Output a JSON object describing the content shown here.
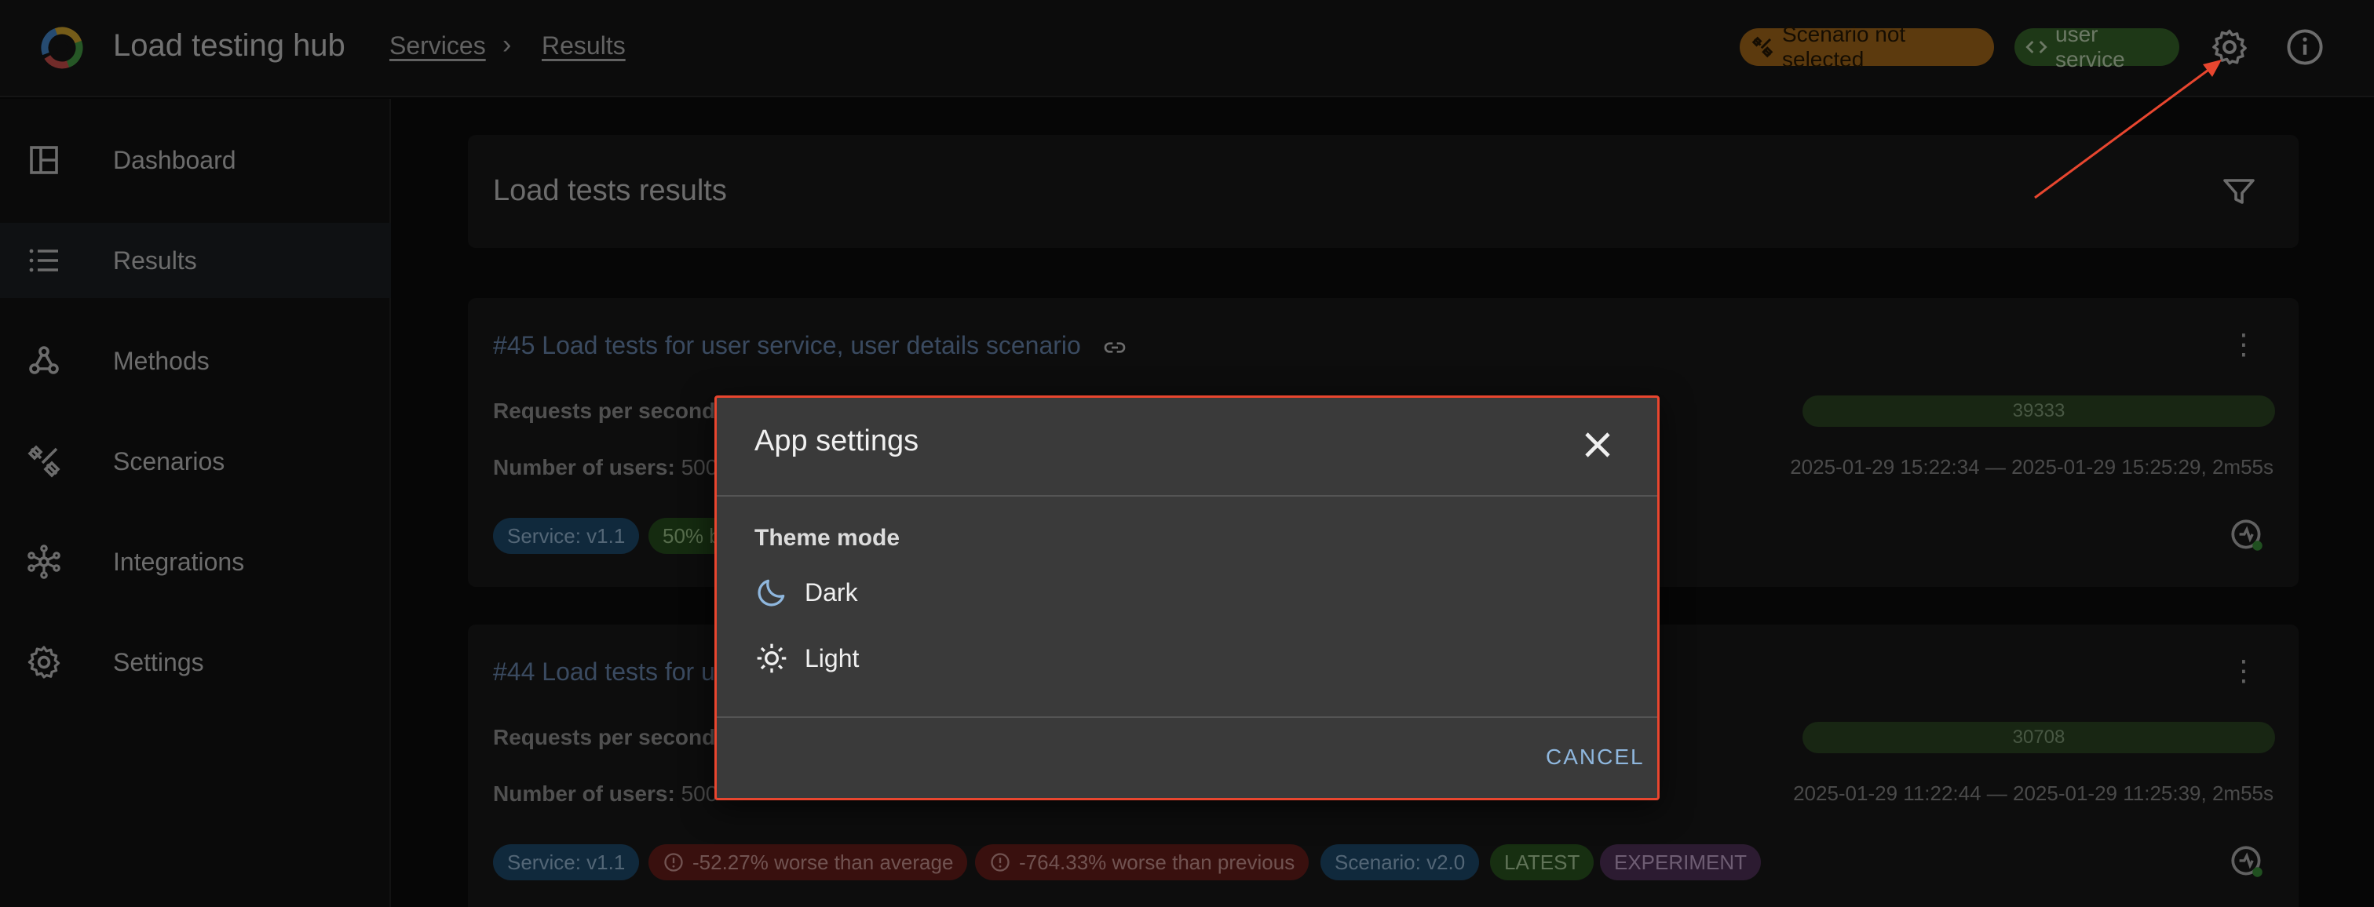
{
  "topbar": {
    "app_title": "Load testing hub",
    "breadcrumb": [
      "Services",
      "Results"
    ],
    "scenario_chip": "Scenario not selected",
    "service_chip": "user service"
  },
  "sidebar": {
    "items": [
      {
        "label": "Dashboard",
        "icon": "dashboard-icon"
      },
      {
        "label": "Results",
        "icon": "list-icon",
        "active": true
      },
      {
        "label": "Methods",
        "icon": "webhook-icon"
      },
      {
        "label": "Scenarios",
        "icon": "tools-icon"
      },
      {
        "label": "Integrations",
        "icon": "hub-icon"
      },
      {
        "label": "Settings",
        "icon": "gear-icon"
      }
    ]
  },
  "results": {
    "header_title": "Load tests results",
    "cards": [
      {
        "title": "#45 Load tests for user service, user details scenario",
        "rps_label": "Requests per second:",
        "users_label": "Number of users:",
        "users_value": "500",
        "rps_bar": "39333",
        "date_range": "2025-01-29 15:22:34 — 2025-01-29 15:25:29, 2m55s",
        "chips": [
          "Service: v1.1",
          "50% b"
        ]
      },
      {
        "title": "#44 Load tests for u",
        "rps_label": "Requests per second:",
        "users_label": "Number of users:",
        "users_value": "500",
        "rps_bar": "30708",
        "date_range": "2025-01-29 11:22:44 — 2025-01-29 11:25:39, 2m55s",
        "chips": [
          "Service: v1.1",
          "-52.27% worse than average",
          "-764.33% worse than previous",
          "Scenario: v2.0",
          "LATEST",
          "EXPERIMENT"
        ]
      }
    ]
  },
  "dialog": {
    "title": "App settings",
    "section": "Theme mode",
    "options": [
      "Dark",
      "Light"
    ],
    "cancel": "CANCEL"
  },
  "colors": {
    "accent_border": "#e8462f",
    "link_blue": "#8fb7de",
    "orange_chip": "#b0701c",
    "green_chip": "#3a6b2c"
  }
}
